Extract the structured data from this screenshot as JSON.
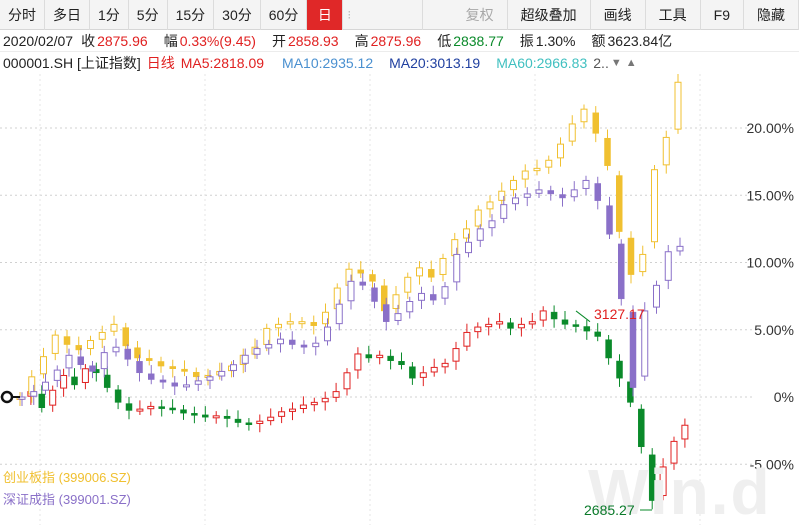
{
  "toolbar": {
    "periods": [
      "分时",
      "多日",
      "1分",
      "5分",
      "15分",
      "30分",
      "60分",
      "日"
    ],
    "active_period": "日",
    "tools": [
      "复权",
      "超级叠加",
      "画线",
      "工具",
      "F9",
      "隐藏"
    ],
    "disabled_tool": "复权"
  },
  "quote": {
    "date": "2020/02/07",
    "close_label": "收",
    "close": "2875.96",
    "change_label": "幅",
    "change": "0.33%(9.45)",
    "open_label": "开",
    "open": "2858.93",
    "high_label": "高",
    "high": "2875.96",
    "low_label": "低",
    "low": "2838.77",
    "amplitude_label": "振",
    "amplitude": "1.30%",
    "amount_label": "额",
    "amount": "3623.84亿"
  },
  "ma_line": {
    "symbol": "000001.SH [上证指数]",
    "period": "日线",
    "ma5": "MA5:2818.09",
    "ma10": "MA10:2935.12",
    "ma20": "MA20:3013.19",
    "ma60": "MA60:2966.83",
    "more": "2.."
  },
  "legend": {
    "series1": "创业板指 (399006.SZ)",
    "series2": "深证成指 (399001.SZ)"
  },
  "annotations": {
    "high": "3127.17",
    "low": "2685.27"
  },
  "watermark": "Win.d",
  "colors": {
    "up": "#e02020",
    "down": "#0a8a2a",
    "chinext": "#f0c030",
    "szse": "#8a70c8",
    "ma5": "#e02020",
    "ma10": "#4a90d0",
    "ma20": "#2040a0",
    "ma60": "#40c0c0"
  },
  "chart_data": {
    "type": "candlestick",
    "y_axis": {
      "unit": "percent change",
      "ticks": [
        "20.00%",
        "15.00%",
        "10.00%",
        "5.00%",
        "0%",
        "-5.00%"
      ],
      "tick_values": [
        20,
        15,
        10,
        5,
        0,
        -5
      ],
      "range": [
        -9,
        24
      ]
    },
    "grid": true,
    "series": [
      {
        "name": "000001.SH [上证指数]",
        "display": "red up / green down candles",
        "values": [
          0,
          0.4,
          -0.8,
          0.5,
          1.6,
          0.9,
          2.1,
          1.8,
          0.7,
          -0.4,
          -1,
          -0.9,
          -0.7,
          -0.8,
          -0.9,
          -1.2,
          -1.3,
          -1.5,
          -1.4,
          -1.6,
          -1.9,
          -2,
          -1.8,
          -1.5,
          -1.1,
          -0.9,
          -0.6,
          -0.4,
          -0.1,
          0.4,
          1.8,
          3.2,
          2.9,
          3.1,
          2.7,
          2.4,
          1.4,
          1.8,
          2.2,
          2.5,
          3.6,
          4.8,
          5.2,
          5.4,
          5.6,
          5.1,
          5.4,
          5.6,
          6.4,
          5.8,
          5.4,
          5.3,
          4.9,
          4.5,
          2.9,
          1.4,
          -0.4,
          -3.7,
          -7.7,
          -5.2,
          -3.3,
          -2.1
        ]
      },
      {
        "name": "创业板指 (399006.SZ)",
        "display": "yellow candles",
        "values": [
          0,
          1.5,
          3,
          4.6,
          3.9,
          3.5,
          4.2,
          4.8,
          5.4,
          3.8,
          2.9,
          2.7,
          2.3,
          2.1,
          1.9,
          1.5,
          1.6,
          1.9,
          2.3,
          3.1,
          3.7,
          5.1,
          5.4,
          5.6,
          5.6,
          5.3,
          6.3,
          8.1,
          9.5,
          9.2,
          8.6,
          6.4,
          7.6,
          8.9,
          9.6,
          8.9,
          10.3,
          11.7,
          12.5,
          13.9,
          14.5,
          15.3,
          16.1,
          16.8,
          17,
          17.6,
          18.8,
          20.3,
          21.4,
          19.6,
          17.2,
          12.3,
          9.1,
          10.6,
          16.9,
          19.3,
          23.4
        ]
      },
      {
        "name": "深证成指 (399001.SZ)",
        "display": "purple candles",
        "values": [
          0,
          0.4,
          1.1,
          2,
          3.1,
          2.4,
          1.9,
          3.3,
          3.7,
          2.8,
          1.8,
          1.3,
          1.1,
          0.8,
          0.9,
          1.2,
          1.5,
          1.9,
          2.4,
          3.1,
          3.6,
          3.9,
          4.3,
          3.9,
          3.7,
          4,
          5.2,
          6.9,
          8.6,
          8.3,
          7.1,
          5.6,
          6.2,
          7.1,
          7.7,
          7.2,
          8.2,
          10.6,
          11.5,
          12.5,
          13.1,
          14.3,
          14.8,
          15.1,
          15.4,
          15.1,
          14.8,
          15.4,
          16.1,
          14.6,
          12.1,
          7.3,
          0.7,
          6.4,
          8.3,
          10.8,
          11.2
        ]
      }
    ],
    "annotations": [
      {
        "label": "3127.17",
        "series": "000001.SH [上证指数]",
        "value": 6.4
      },
      {
        "label": "2685.27",
        "series": "000001.SH [上证指数]",
        "value": -8.3
      }
    ]
  }
}
